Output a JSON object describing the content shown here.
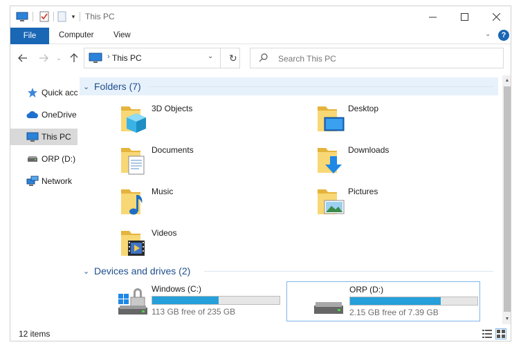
{
  "window": {
    "title": "This PC"
  },
  "ribbon": {
    "tabs": [
      "File",
      "Computer",
      "View"
    ]
  },
  "address": {
    "path": "This PC",
    "search_placeholder": "Search This PC"
  },
  "sidebar": {
    "items": [
      {
        "label": "Quick access",
        "icon": "star-icon",
        "selected": false
      },
      {
        "label": "OneDrive",
        "icon": "cloud-icon",
        "selected": false
      },
      {
        "label": "This PC",
        "icon": "computer-icon",
        "selected": true
      },
      {
        "label": "ORP (D:)",
        "icon": "drive-icon",
        "selected": false
      },
      {
        "label": "Network",
        "icon": "network-icon",
        "selected": false
      }
    ]
  },
  "folders": {
    "header": "Folders (7)",
    "items": [
      {
        "label": "3D Objects",
        "icon": "3d-objects-folder-icon"
      },
      {
        "label": "Desktop",
        "icon": "desktop-folder-icon"
      },
      {
        "label": "Documents",
        "icon": "documents-folder-icon"
      },
      {
        "label": "Downloads",
        "icon": "downloads-folder-icon"
      },
      {
        "label": "Music",
        "icon": "music-folder-icon"
      },
      {
        "label": "Pictures",
        "icon": "pictures-folder-icon"
      },
      {
        "label": "Videos",
        "icon": "videos-folder-icon"
      }
    ]
  },
  "drives": {
    "header": "Devices and drives (2)",
    "items": [
      {
        "name": "Windows (C:)",
        "free": "113 GB free of 235 GB",
        "used_fraction": 0.52,
        "selected": false
      },
      {
        "name": "ORP (D:)",
        "free": "2.15 GB free of 7.39 GB",
        "used_fraction": 0.71,
        "selected": true
      }
    ]
  },
  "status": {
    "items_count": "12 items"
  },
  "colors": {
    "accent": "#1a67b5",
    "drive_bar": "#26a0da",
    "header_text": "#1e4e8c",
    "folder": "#f4c952"
  }
}
